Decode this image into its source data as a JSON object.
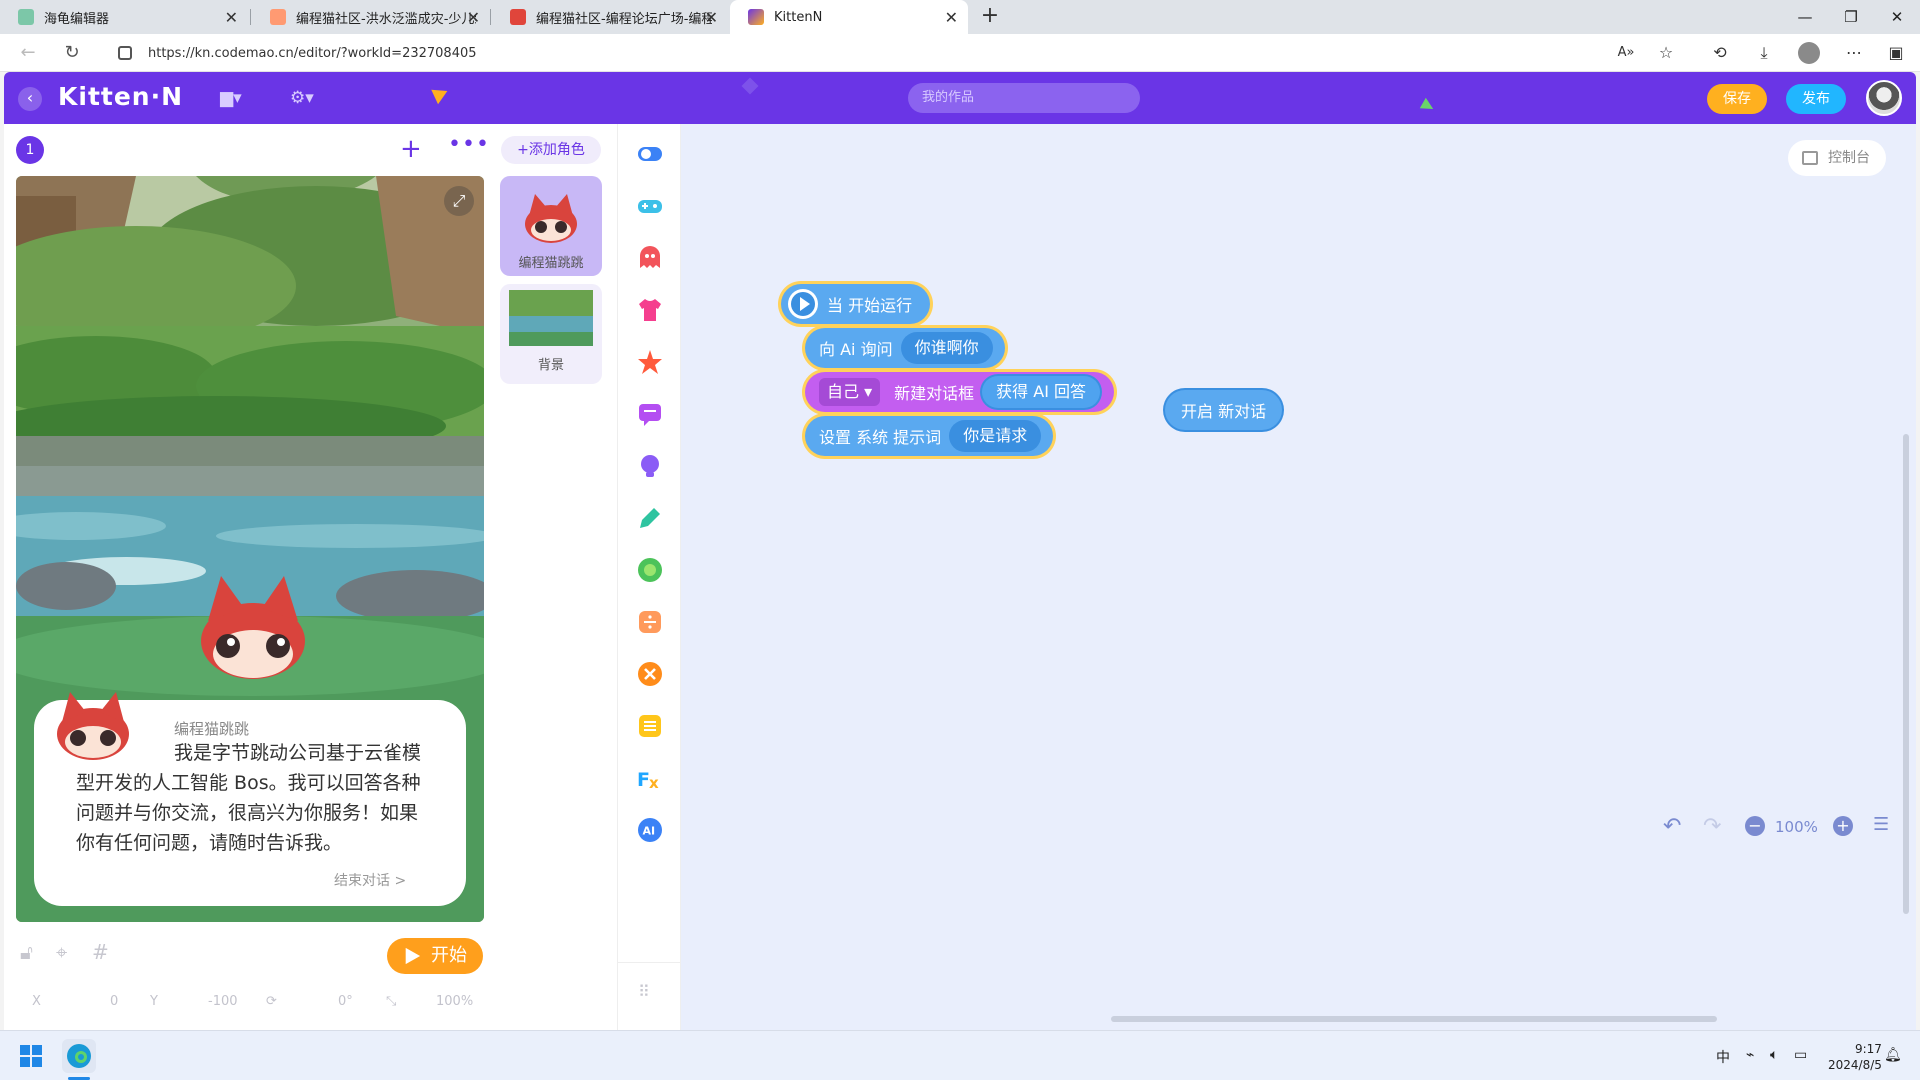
{
  "browser": {
    "tabs": [
      {
        "title": "海龟编辑器",
        "active": false
      },
      {
        "title": "编程猫社区-洪水泛滥成灾-少儿编",
        "active": false
      },
      {
        "title": "编程猫社区-编程论坛广场-编程猫",
        "active": false
      },
      {
        "title": "KittenN",
        "active": true
      }
    ],
    "url": "https://kn.codemao.cn/editor/?workId=232708405"
  },
  "app": {
    "logo": "Kitten·N",
    "search_placeholder": "我的作品",
    "save_label": "保存",
    "publish_label": "发布",
    "brand_color": "#6a35e6"
  },
  "stage_panel": {
    "scene_number": "1",
    "add_role_label": "+添加角色",
    "roles": [
      {
        "name": "编程猫跳跳",
        "selected": true
      },
      {
        "name": "背景",
        "selected": false
      }
    ],
    "dialog": {
      "speaker": "编程猫跳跳",
      "text": "我是字节跳动公司基于云雀模型开发的人工智能 Bos。我可以回答各种问题并与你交流，很高兴为你服务！如果你有任何问题，请随时告诉我。",
      "end_label": "结束对话 >"
    },
    "start_label": "开始",
    "coords": {
      "x_label": "X",
      "x": "0",
      "y_label": "Y",
      "y": "-100",
      "rotation": "0°",
      "scale": "100%"
    }
  },
  "palette": {
    "icons": [
      "events-toggle-icon",
      "controls-gamepad-icon",
      "actions-ghost-icon",
      "appearance-shirt-icon",
      "sound-star-icon",
      "dialog-chat-icon",
      "bulb-icon",
      "pen-icon",
      "sensing-circle-icon",
      "math-divide-icon",
      "logic-cross-icon",
      "list-icon",
      "function-fx-icon",
      "ai-icon"
    ]
  },
  "workspace": {
    "console_label": "控制台",
    "blocks": {
      "hat": "当 开始运行",
      "ask_prefix": "向 Ai 询问",
      "ask_arg": "你谁啊你",
      "self_dropdown": "自己",
      "new_dialog": "新建对话框",
      "get_answer": "获得 AI 回答",
      "set_prompt": "设置 系统 提示词",
      "prompt_arg": "你是请求",
      "new_conversation": "开启 新对话"
    },
    "zoom": "100%"
  },
  "taskbar": {
    "ime": "中",
    "time": "9:17",
    "date": "2024/8/5"
  }
}
